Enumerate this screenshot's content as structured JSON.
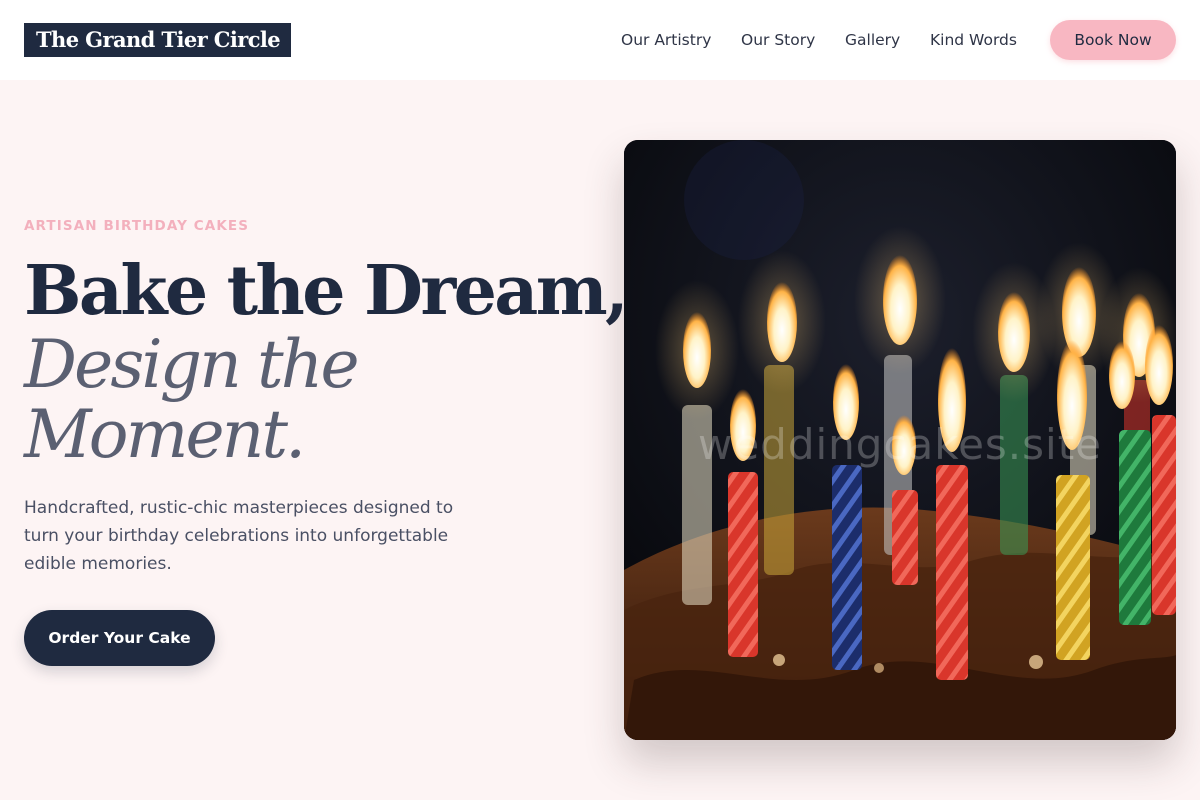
{
  "header": {
    "logo": "The Grand Tier Circle",
    "nav": [
      "Our Artistry",
      "Our Story",
      "Gallery",
      "Kind Words"
    ],
    "cta_label": "Book Now"
  },
  "hero": {
    "eyebrow": "ARTISAN BIRTHDAY CAKES",
    "headline_line1": "Bake the Dream,",
    "headline_line2": "Design the Moment.",
    "description": "Handcrafted, rustic-chic masterpieces designed to turn your birthday celebrations into unforgettable edible memories.",
    "cta_label": "Order Your Cake",
    "image": {
      "subject": "chocolate-birthday-cake-with-lit-candles",
      "watermark": "weddingcakes.site"
    }
  },
  "colors": {
    "page_background": "#fdf4f4",
    "navy": "#1f2a40",
    "pink_accent": "#f8b7c2",
    "muted_gray": "#5b6072"
  }
}
